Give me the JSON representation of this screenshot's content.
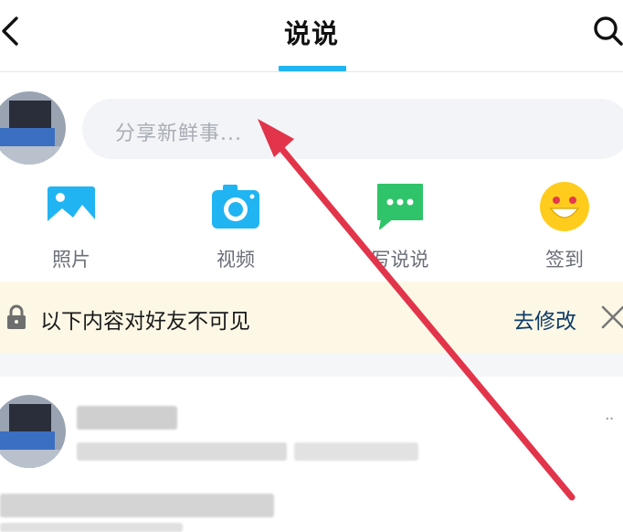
{
  "header": {
    "title": "说说"
  },
  "composer": {
    "placeholder": "分享新鲜事..."
  },
  "actions": [
    {
      "label": "照片",
      "icon": "image-icon"
    },
    {
      "label": "视频",
      "icon": "camera-icon"
    },
    {
      "label": "写说说",
      "icon": "chat-bubble-icon"
    },
    {
      "label": "签到",
      "icon": "smiley-icon"
    }
  ],
  "notice": {
    "text": "以下内容对好友不可见",
    "link": "去修改"
  },
  "feed": {
    "more": "··"
  },
  "colors": {
    "accent": "#21b4f2",
    "chat_green": "#2fc46a",
    "notice_bg": "#fdf8e6",
    "arrow_red": "#e2344a"
  }
}
